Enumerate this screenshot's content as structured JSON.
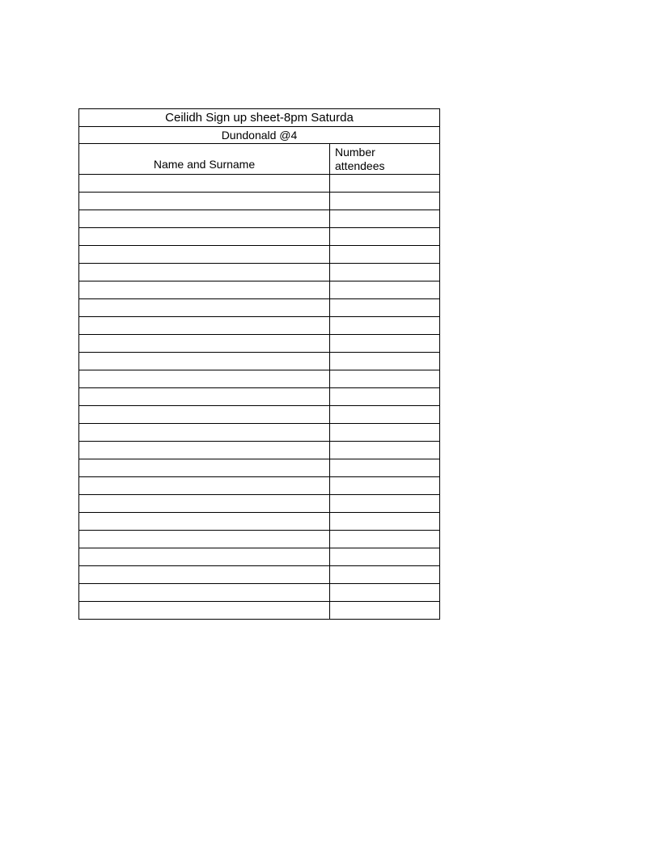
{
  "title": "Ceilidh Sign up sheet-8pm Saturda",
  "subtitle": "Dundonald @4",
  "columns": {
    "name": "Name and Surname",
    "number_line1": "Number",
    "number_line2": "attendees"
  },
  "row_count": 25
}
